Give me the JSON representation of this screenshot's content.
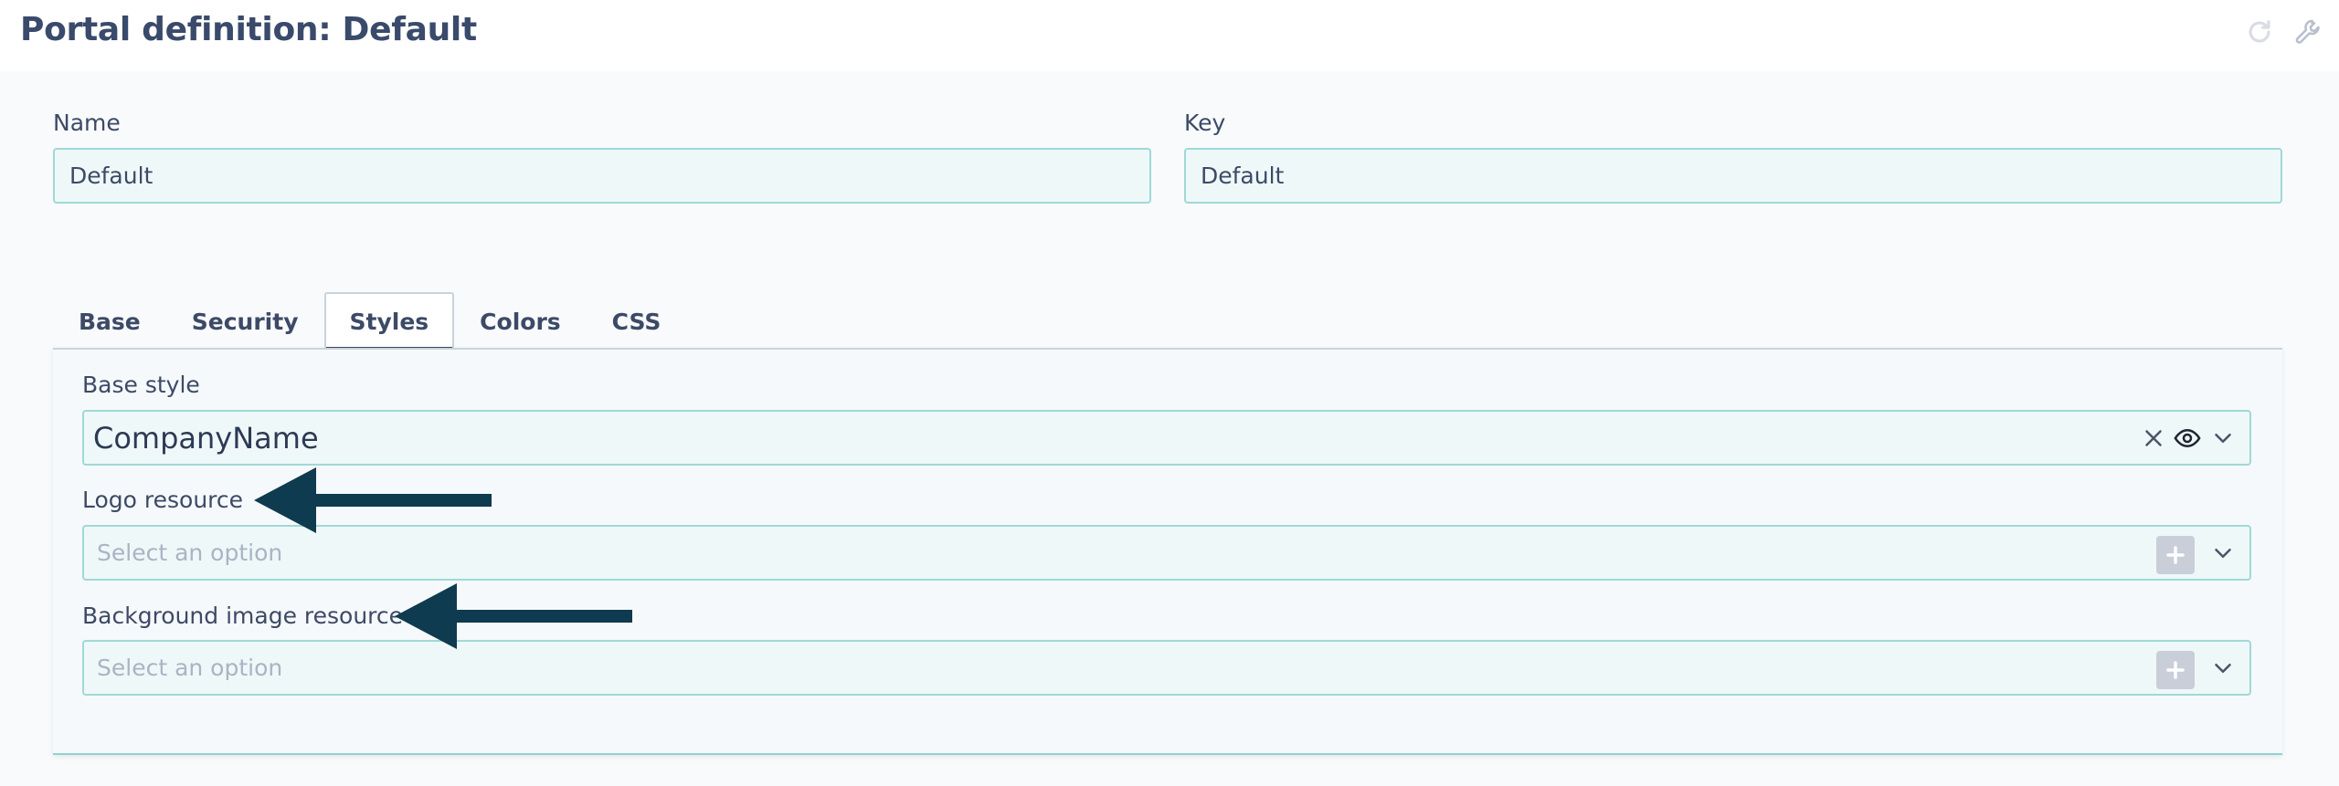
{
  "header": {
    "title": "Portal definition: Default"
  },
  "form": {
    "name": {
      "label": "Name",
      "value": "Default"
    },
    "key": {
      "label": "Key",
      "value": "Default"
    }
  },
  "tabs": [
    {
      "label": "Base",
      "active": false
    },
    {
      "label": "Security",
      "active": false
    },
    {
      "label": "Styles",
      "active": true
    },
    {
      "label": "Colors",
      "active": false
    },
    {
      "label": "CSS",
      "active": false
    }
  ],
  "styles_panel": {
    "base_style": {
      "label": "Base style",
      "value": "CompanyName"
    },
    "logo_resource": {
      "label": "Logo resource",
      "placeholder": "Select an option"
    },
    "background_resource": {
      "label": "Background image resource",
      "placeholder": "Select an option"
    }
  },
  "colors": {
    "title": "#3a4a6b",
    "input_border": "#9fd9d6",
    "input_bg": "#eef8f9",
    "arrow": "#0e3b4f",
    "placeholder": "#a9b4c4"
  },
  "icons": [
    "refresh-icon",
    "wrench-icon",
    "clear-icon",
    "eye-icon",
    "chevron-down-icon",
    "plus-icon",
    "arrow-annotation"
  ]
}
